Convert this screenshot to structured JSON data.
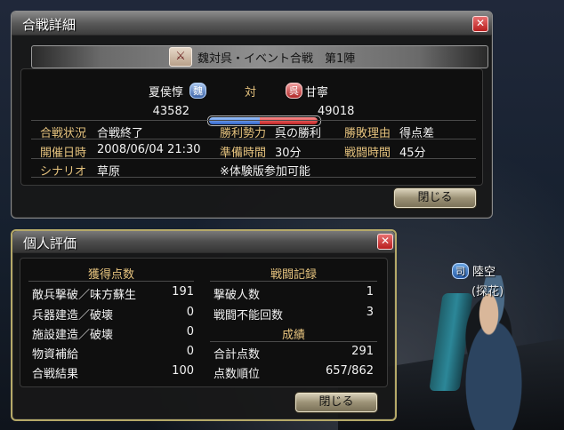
{
  "battle_window": {
    "title": "合戦詳細",
    "banner_icon": "crossed-swords-icon",
    "banner_text": "魏対呉・イベント合戦　第1陣",
    "left_commander": "夏侯惇",
    "left_faction": "魏",
    "versus": "対",
    "right_faction": "呉",
    "right_commander": "甘寧",
    "left_score": "43582",
    "right_score": "49018",
    "score_share_left": 0.47,
    "rows": [
      {
        "l1": "合戦状況",
        "v1": "合戦終了",
        "l2": "勝利勢力",
        "v2": "呉の勝利",
        "l3": "勝敗理由",
        "v3": "得点差"
      },
      {
        "l1": "開催日時",
        "v1": "2008/06/04 21:30",
        "l2": "準備時間",
        "v2": "30分",
        "l3": "戦闘時間",
        "v3": "45分"
      },
      {
        "l1": "シナリオ",
        "v1": "草原",
        "note": "※体験版参加可能"
      }
    ],
    "close_label": "閉じる"
  },
  "personal_window": {
    "title": "個人評価",
    "left_header": "獲得点数",
    "left_rows": [
      {
        "label": "敵兵撃破／味方蘇生",
        "value": "191"
      },
      {
        "label": "兵器建造／破壊",
        "value": "0"
      },
      {
        "label": "施設建造／破壊",
        "value": "0"
      },
      {
        "label": "物資補給",
        "value": "0"
      },
      {
        "label": "合戦結果",
        "value": "100"
      }
    ],
    "right_header": "戦闘記録",
    "right_rows": [
      {
        "label": "撃破人数",
        "value": "1"
      },
      {
        "label": "戦闘不能回数",
        "value": "3"
      }
    ],
    "results_header": "成績",
    "results_rows": [
      {
        "label": "合計点数",
        "value": "291"
      },
      {
        "label": "点数順位",
        "value": "657/862"
      }
    ],
    "close_label": "閉じる"
  },
  "character": {
    "faction_badge": "司",
    "name": "陸空",
    "title": "(探花)"
  }
}
